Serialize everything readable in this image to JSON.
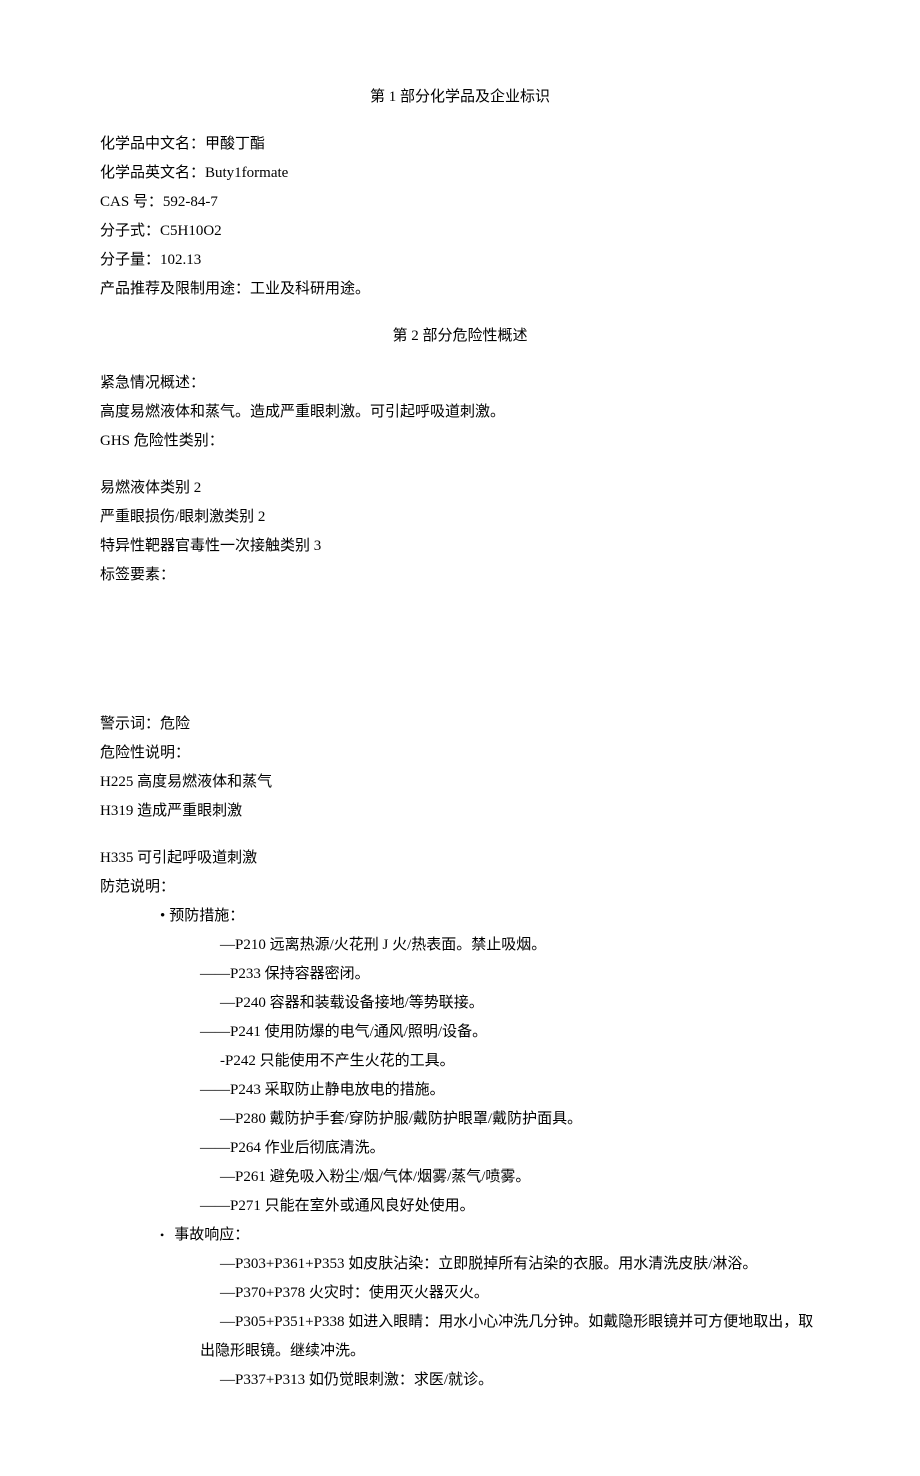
{
  "section1": {
    "title": "第 1 部分化学品及企业标识",
    "fields": {
      "name_cn": "化学品中文名：甲酸丁酯",
      "name_en": "化学品英文名：Buty1formate",
      "cas": "CAS 号：592-84-7",
      "formula": "分子式：C5H10O2",
      "mw": "分子量：102.13",
      "usage": "产品推荐及限制用途：工业及科研用途。"
    }
  },
  "section2": {
    "title": "第 2 部分危险性概述",
    "emergency_label": "紧急情况概述：",
    "emergency_text": "高度易燃液体和蒸气。造成严重眼刺激。可引起呼吸道刺激。",
    "ghs_label": "GHS 危险性类别：",
    "ghs_classes": [
      "易燃液体类别 2",
      "严重眼损伤/眼刺激类别 2",
      "特异性靶器官毒性一次接触类别 3"
    ],
    "label_elements": "标签要素：",
    "signal_word": "警示词：危险",
    "hazard_label": "危险性说明：",
    "hazard_statements": [
      "H225 高度易燃液体和蒸气",
      "H319 造成严重眼刺激",
      "H335 可引起呼吸道刺激"
    ],
    "precaution_label": "防范说明：",
    "prevention": {
      "title": "预防措施：",
      "items": [
        "—P210 远离热源/火花刑 J 火/热表面。禁止吸烟。",
        "——P233 保持容器密闭。",
        "—P240 容器和装载设备接地/等势联接。",
        "——P241 使用防爆的电气/通风/照明/设备。",
        "-P242 只能使用不产生火花的工具。",
        "——P243 采取防止静电放电的措施。",
        "—P280 戴防护手套/穿防护服/戴防护眼罩/戴防护面具。",
        "——P264 作业后彻底清洗。",
        "—P261 避免吸入粉尘/烟/气体/烟雾/蒸气/喷雾。",
        "——P271 只能在室外或通风良好处使用。"
      ]
    },
    "response": {
      "title": "事故响应：",
      "items": [
        {
          "t": "—P303+P361+P353 如皮肤沾染：立即脱掉所有沾染的衣服。用水清洗皮肤/淋浴。"
        },
        {
          "t": "—P370+P378 火灾时：使用灭火器灭火。"
        },
        {
          "t": "—P305+P351+P338 如进入眼睛：用水小心冲洗几分钟。如戴隐形眼镜并可方便地取出，取",
          "cont": "出隐形眼镜。继续冲洗。"
        },
        {
          "t": "—P337+P313 如仍觉眼刺激：求医/就诊。"
        }
      ]
    }
  }
}
